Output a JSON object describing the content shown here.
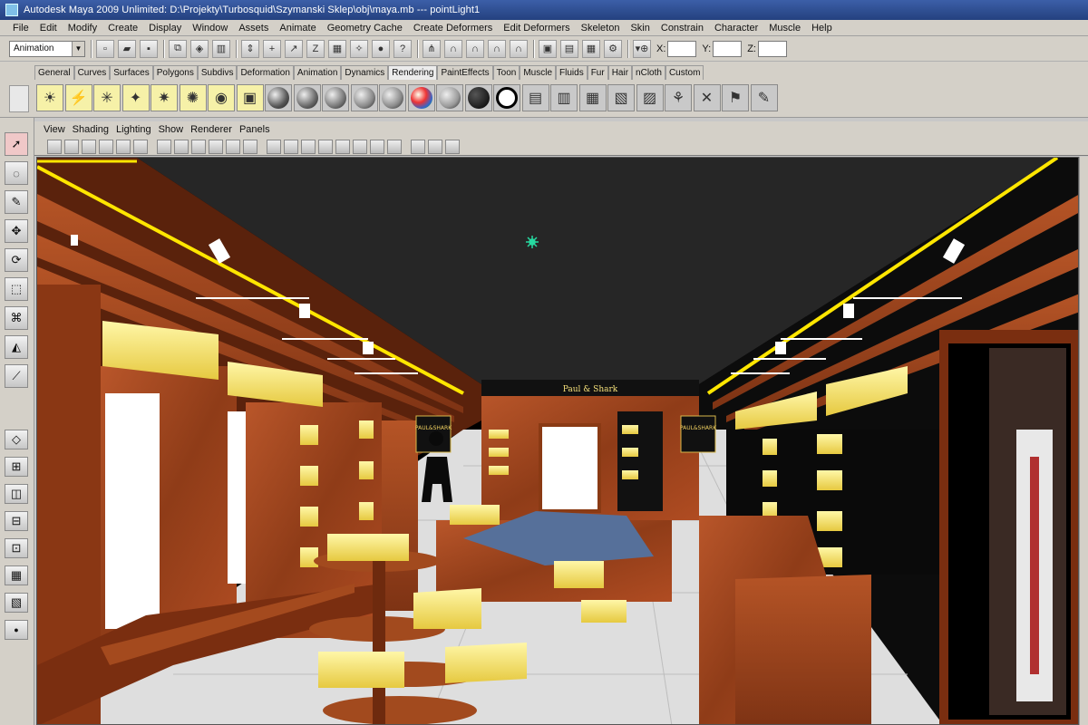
{
  "window": {
    "title": "Autodesk Maya 2009 Unlimited: D:\\Projekty\\Turbosquid\\Szymanski Sklep\\obj\\maya.mb   ---   pointLight1"
  },
  "menubar": {
    "items": [
      "File",
      "Edit",
      "Modify",
      "Create",
      "Display",
      "Window",
      "Assets",
      "Animate",
      "Geometry Cache",
      "Create Deformers",
      "Edit Deformers",
      "Skeleton",
      "Skin",
      "Constrain",
      "Character",
      "Muscle",
      "Help"
    ]
  },
  "statusline": {
    "mode": "Animation",
    "x_label": "X:",
    "y_label": "Y:",
    "z_label": "Z:",
    "x_value": "",
    "y_value": "",
    "z_value": ""
  },
  "shelf": {
    "tabs": [
      "General",
      "Curves",
      "Surfaces",
      "Polygons",
      "Subdivs",
      "Deformation",
      "Animation",
      "Dynamics",
      "Rendering",
      "PaintEffects",
      "Toon",
      "Muscle",
      "Fluids",
      "Fur",
      "Hair",
      "nCloth",
      "Custom"
    ],
    "active_tab": "Rendering",
    "icons": [
      "ambient-light-icon",
      "directional-light-icon",
      "point-light-icon",
      "spot-light-icon",
      "area-light-icon",
      "volume-light-icon",
      "camera-icon",
      "image-plane-icon",
      "blinn-material-icon",
      "lambert-material-icon",
      "phong-material-icon",
      "phonge-material-icon",
      "layered-shader-icon",
      "ramp-shader-icon",
      "surface-shader-icon",
      "use-background-icon",
      "shading-map-icon",
      "render-icon",
      "ipr-render-icon",
      "render-settings-icon",
      "hypershade-icon",
      "render-view-icon",
      "make-link-icon",
      "break-link-icon",
      "render-layer-icon",
      "paint-icon"
    ]
  },
  "panel": {
    "menu": [
      "View",
      "Shading",
      "Lighting",
      "Show",
      "Renderer",
      "Panels"
    ]
  },
  "viewport": {
    "sign_text": "Paul & Shark",
    "emblem_text": "PAUL&SHARK"
  },
  "colors": {
    "title_bar": "#2c4a8c",
    "chrome": "#d4d0c8",
    "ceiling": "#262626",
    "wood": "#a4461c",
    "shelf_highlight": "#f4e97a",
    "yellow_strip": "#ffe600",
    "floor": "#e2e2e2",
    "point_light": "#26d9a0"
  }
}
